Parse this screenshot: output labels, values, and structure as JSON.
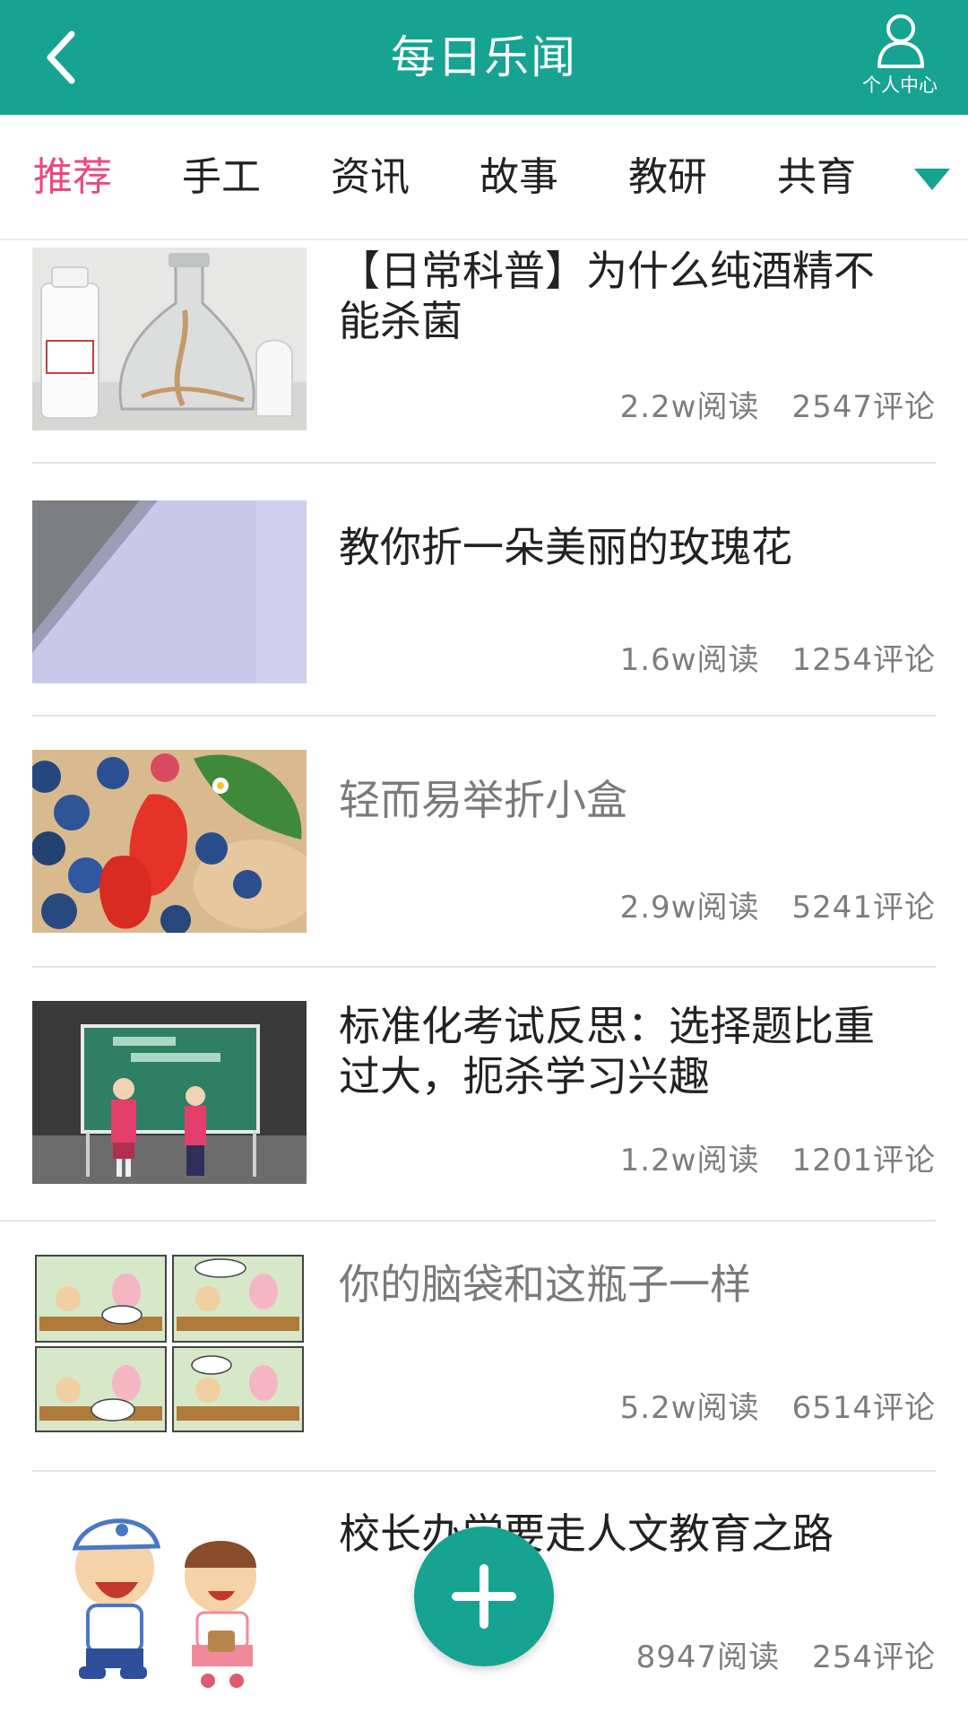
{
  "header": {
    "title": "每日乐闻",
    "profile_label": "个人中心",
    "background_color": "#16a392"
  },
  "tabs": [
    {
      "label": "推荐",
      "active": true
    },
    {
      "label": "手工",
      "active": false
    },
    {
      "label": "资讯",
      "active": false
    },
    {
      "label": "故事",
      "active": false
    },
    {
      "label": "教研",
      "active": false
    },
    {
      "label": "共育",
      "active": false
    }
  ],
  "tab_active_color": "#ea4a7d",
  "articles": [
    {
      "title": "【日常科普】为什么纯酒精不能杀菌",
      "reads": "2.2w阅读",
      "comments": "2547评论",
      "thumbnail": "alcohol-lamp-photo"
    },
    {
      "title": "教你折一朵美丽的玫瑰花",
      "reads": "1.6w阅读",
      "comments": "1254评论",
      "thumbnail": "paper-sheet-photo"
    },
    {
      "title": "轻而易举折小盒",
      "reads": "2.9w阅读",
      "comments": "5241评论",
      "thumbnail": "berries-photo"
    },
    {
      "title": "标准化考试反思：选择题比重过大，扼杀学习兴趣",
      "reads": "1.2w阅读",
      "comments": "1201评论",
      "thumbnail": "students-stage-photo"
    },
    {
      "title": "你的脑袋和这瓶子一样",
      "reads": "5.2w阅读",
      "comments": "6514评论",
      "thumbnail": "comic-strip"
    },
    {
      "title": "校长办学要走人文教育之路",
      "reads": "8947阅读",
      "comments": "254评论",
      "thumbnail": "cartoon-kids"
    }
  ],
  "fab": {
    "icon": "plus-icon"
  }
}
